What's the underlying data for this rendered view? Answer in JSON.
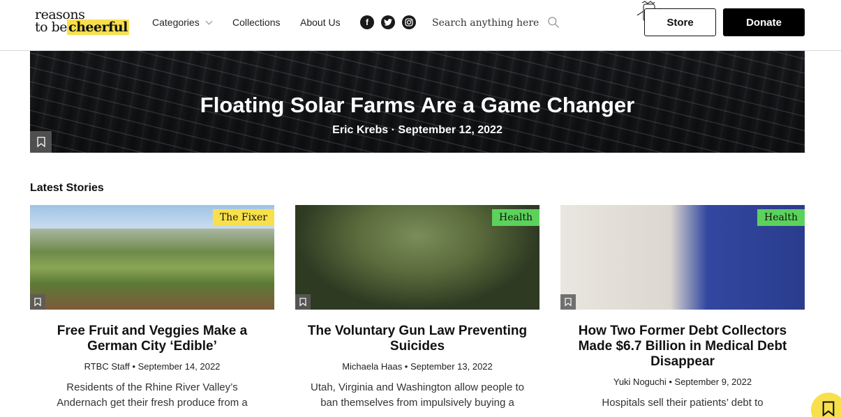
{
  "header": {
    "logo": {
      "line1": "reasons",
      "line2_prefix": "to be",
      "line2_highlight": "cheerful"
    },
    "nav": [
      {
        "label": "Categories",
        "has_dropdown": true
      },
      {
        "label": "Collections"
      },
      {
        "label": "About Us"
      }
    ],
    "social": [
      {
        "icon": "facebook-icon",
        "glyph": "f"
      },
      {
        "icon": "twitter-icon",
        "glyph": "t"
      },
      {
        "icon": "instagram-icon",
        "glyph": "◎"
      }
    ],
    "search": {
      "placeholder": "Search anything here..."
    },
    "store_label": "Store",
    "donate_label": "Donate"
  },
  "hero": {
    "title": "Floating Solar Farms Are a Game Changer",
    "meta": "Eric Krebs · September 12, 2022"
  },
  "latest": {
    "heading": "Latest Stories",
    "cards": [
      {
        "tag": "The Fixer",
        "title": "Free Fruit and Veggies Make a German City ‘Edible’",
        "meta": "RTBC Staff • September 14, 2022",
        "excerpt": "Residents of the Rhine River Valley’s Andernach get their fresh produce from a"
      },
      {
        "tag": "Health",
        "title": "The Voluntary Gun Law Preventing Suicides",
        "meta": "Michaela Haas • September 13, 2022",
        "excerpt": "Utah, Virginia and Washington allow people to ban themselves from impulsively buying a"
      },
      {
        "tag": "Health",
        "title": "How Two Former Debt Collectors Made $6.7 Billion in Medical Debt Disappear",
        "meta": "Yuki Noguchi • September 9, 2022",
        "excerpt": "Hospitals sell their patients’ debt to"
      }
    ]
  },
  "colors": {
    "accent_yellow": "#f7e04b",
    "tag_green": "#5bd25b",
    "black": "#000000"
  }
}
